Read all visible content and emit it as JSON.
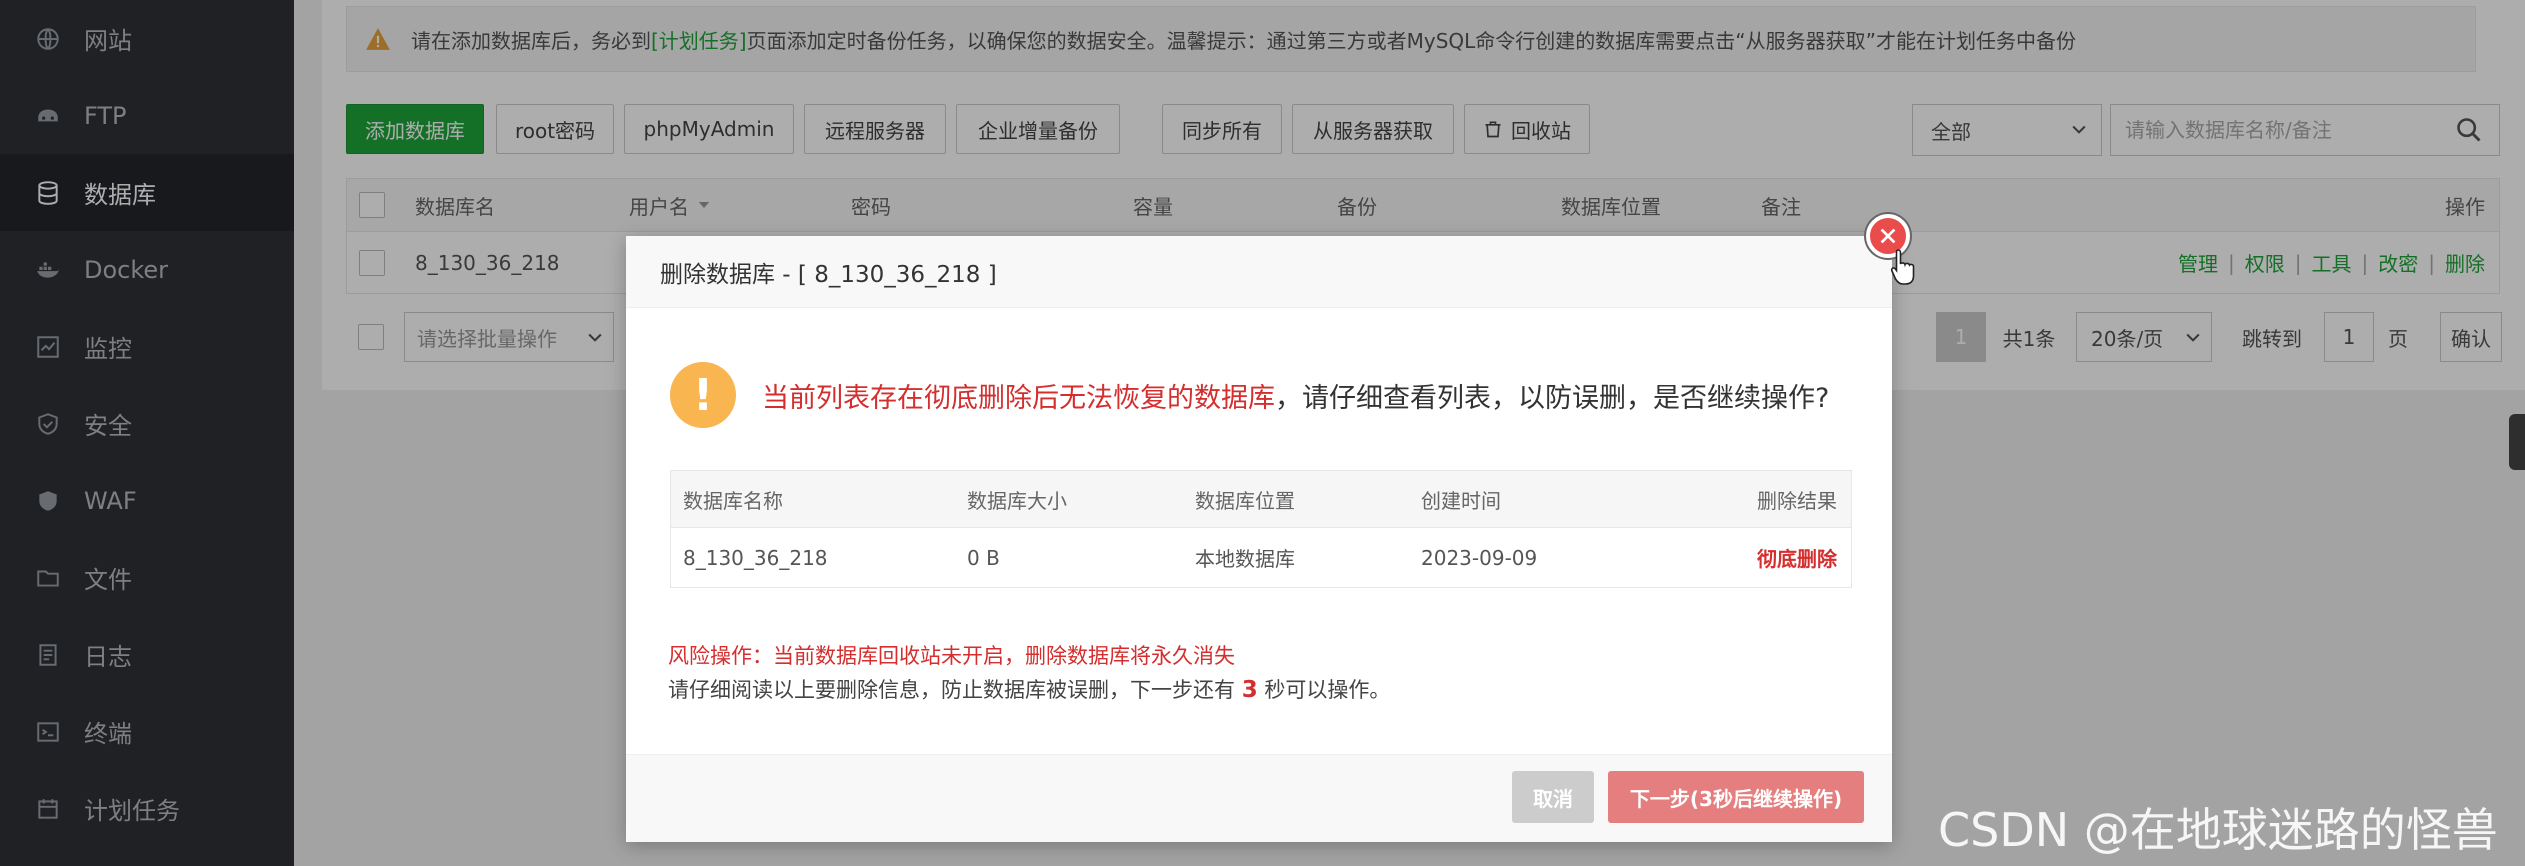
{
  "sidebar": {
    "items": [
      {
        "label": "网站",
        "icon": "globe-icon"
      },
      {
        "label": "FTP",
        "icon": "ftp-icon"
      },
      {
        "label": "数据库",
        "icon": "database-icon",
        "active": true
      },
      {
        "label": "Docker",
        "icon": "docker-icon"
      },
      {
        "label": "监控",
        "icon": "monitor-icon"
      },
      {
        "label": "安全",
        "icon": "shield-icon"
      },
      {
        "label": "WAF",
        "icon": "waf-shield-icon"
      },
      {
        "label": "文件",
        "icon": "folder-icon"
      },
      {
        "label": "日志",
        "icon": "log-icon"
      },
      {
        "label": "终端",
        "icon": "terminal-icon"
      },
      {
        "label": "计划任务",
        "icon": "calendar-icon"
      }
    ]
  },
  "notice": {
    "before": "请在添加数据库后，务必到",
    "link": "[计划任务]",
    "after": "页面添加定时备份任务，以确保您的数据安全。温馨提示：通过第三方或者MySQL命令行创建的数据库需要点击“从服务器获取”才能在计划任务中备份"
  },
  "toolbar": {
    "add_db": "添加数据库",
    "root_pwd": "root密码",
    "phpmyadmin": "phpMyAdmin",
    "remote": "远程服务器",
    "incremental": "企业增量备份",
    "sync_all": "同步所有",
    "fetch": "从服务器获取",
    "recycle": "回收站",
    "filter_value": "全部",
    "search_placeholder": "请输入数据库名称/备注"
  },
  "table": {
    "headers": {
      "name": "数据库名",
      "user": "用户名",
      "password": "密码",
      "capacity": "容量",
      "backup": "备份",
      "location": "数据库位置",
      "remark": "备注",
      "ops": "操作"
    },
    "row": {
      "name": "8_130_36_218",
      "ops": [
        "管理",
        "权限",
        "工具",
        "改密",
        "删除"
      ]
    }
  },
  "footer": {
    "batch_placeholder": "请选择批量操作",
    "page": "1",
    "total": "共1条",
    "per_page": "20条/页",
    "goto": "跳转到",
    "goto_value": "1",
    "page_unit": "页",
    "confirm": "确认"
  },
  "dialog": {
    "title": "删除数据库 - [ 8_130_36_218 ]",
    "alert_red": "当前列表存在彻底删除后无法恢复的数据库",
    "alert_rest": "，请仔细查看列表，以防误删，是否继续操作?",
    "table": {
      "headers": {
        "name": "数据库名称",
        "size": "数据库大小",
        "location": "数据库位置",
        "created": "创建时间",
        "result": "删除结果"
      },
      "row": {
        "name": "8_130_36_218",
        "size": "0 B",
        "location": "本地数据库",
        "created": "2023-09-09",
        "result": "彻底删除"
      }
    },
    "risk": "风险操作：当前数据库回收站未开启，删除数据库将永久消失",
    "note_before": "请仔细阅读以上要删除信息，防止数据库被误删，下一步还有",
    "countdown": "3",
    "note_after": "秒可以操作。",
    "cancel": "取消",
    "next": "下一步(3秒后继续操作)"
  },
  "watermark": "CSDN @在地球迷路的怪兽",
  "colors": {
    "accent_green": "#20a53a",
    "danger_red": "#d42e2e",
    "warning_orange": "#f8b550",
    "sidebar_bg": "#2f3237"
  }
}
